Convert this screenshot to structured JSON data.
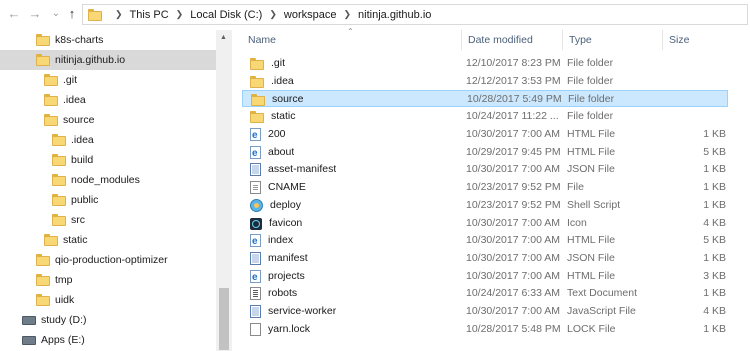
{
  "address": {
    "back_glyph": "←",
    "forward_glyph": "→",
    "recent_glyph": "⌄",
    "up_glyph": "↑",
    "crumbs": [
      "This PC",
      "Local Disk (C:)",
      "workspace",
      "nitinja.github.io"
    ]
  },
  "sidebar": {
    "items": [
      {
        "label": "k8s-charts",
        "icon": "folder-icon",
        "indent": 0
      },
      {
        "label": "nitinja.github.io",
        "icon": "folder-icon",
        "indent": 0,
        "selected": true
      },
      {
        "label": ".git",
        "icon": "folder-icon",
        "indent": 1
      },
      {
        "label": ".idea",
        "icon": "folder-icon",
        "indent": 1
      },
      {
        "label": "source",
        "icon": "folder-icon",
        "indent": 1
      },
      {
        "label": ".idea",
        "icon": "folder-icon",
        "indent": 2
      },
      {
        "label": "build",
        "icon": "folder-icon",
        "indent": 2
      },
      {
        "label": "node_modules",
        "icon": "folder-icon",
        "indent": 2
      },
      {
        "label": "public",
        "icon": "folder-icon",
        "indent": 2
      },
      {
        "label": "src",
        "icon": "folder-icon",
        "indent": 2
      },
      {
        "label": "static",
        "icon": "folder-icon",
        "indent": 1
      },
      {
        "label": "qio-production-optimizer",
        "icon": "folder-icon",
        "indent": 0
      },
      {
        "label": "tmp",
        "icon": "folder-icon",
        "indent": 0
      },
      {
        "label": "uidk",
        "icon": "folder-icon",
        "indent": 0
      },
      {
        "label": "study (D:)",
        "icon": "drive-icon",
        "indent": -1
      },
      {
        "label": "Apps (E:)",
        "icon": "drive-icon",
        "indent": -1
      }
    ]
  },
  "list": {
    "columns": {
      "name": "Name",
      "date": "Date modified",
      "type": "Type",
      "size": "Size"
    },
    "sort_glyph": "⌃",
    "rows": [
      {
        "name": ".git",
        "date": "12/10/2017 8:23 PM",
        "type": "File folder",
        "size": "",
        "icon": "folder"
      },
      {
        "name": ".idea",
        "date": "12/12/2017 3:53 PM",
        "type": "File folder",
        "size": "",
        "icon": "folder"
      },
      {
        "name": "source",
        "date": "10/28/2017 5:49 PM",
        "type": "File folder",
        "size": "",
        "icon": "folder",
        "selected": true
      },
      {
        "name": "static",
        "date": "10/24/2017 11:22 ...",
        "type": "File folder",
        "size": "",
        "icon": "folder"
      },
      {
        "name": "200",
        "date": "10/30/2017 7:00 AM",
        "type": "HTML File",
        "size": "1 KB",
        "icon": "html"
      },
      {
        "name": "about",
        "date": "10/29/2017 9:45 PM",
        "type": "HTML File",
        "size": "5 KB",
        "icon": "html"
      },
      {
        "name": "asset-manifest",
        "date": "10/30/2017 7:00 AM",
        "type": "JSON File",
        "size": "1 KB",
        "icon": "json"
      },
      {
        "name": "CNAME",
        "date": "10/23/2017 9:52 PM",
        "type": "File",
        "size": "1 KB",
        "icon": "doc"
      },
      {
        "name": "deploy",
        "date": "10/23/2017 9:52 PM",
        "type": "Shell Script",
        "size": "1 KB",
        "icon": "shell"
      },
      {
        "name": "favicon",
        "date": "10/30/2017 7:00 AM",
        "type": "Icon",
        "size": "4 KB",
        "icon": "icon"
      },
      {
        "name": "index",
        "date": "10/30/2017 7:00 AM",
        "type": "HTML File",
        "size": "5 KB",
        "icon": "html"
      },
      {
        "name": "manifest",
        "date": "10/30/2017 7:00 AM",
        "type": "JSON File",
        "size": "1 KB",
        "icon": "json"
      },
      {
        "name": "projects",
        "date": "10/30/2017 7:00 AM",
        "type": "HTML File",
        "size": "3 KB",
        "icon": "html"
      },
      {
        "name": "robots",
        "date": "10/24/2017 6:33 AM",
        "type": "Text Document",
        "size": "1 KB",
        "icon": "text"
      },
      {
        "name": "service-worker",
        "date": "10/30/2017 7:00 AM",
        "type": "JavaScript File",
        "size": "4 KB",
        "icon": "js"
      },
      {
        "name": "yarn.lock",
        "date": "10/28/2017 5:48 PM",
        "type": "LOCK File",
        "size": "1 KB",
        "icon": "lock"
      }
    ]
  },
  "colors": {
    "selection_bg": "#cce8ff",
    "selection_border": "#99d1ff",
    "sidebar_selected": "#d9d9d9",
    "header_text": "#4c607a",
    "folder": "#f8d775"
  }
}
